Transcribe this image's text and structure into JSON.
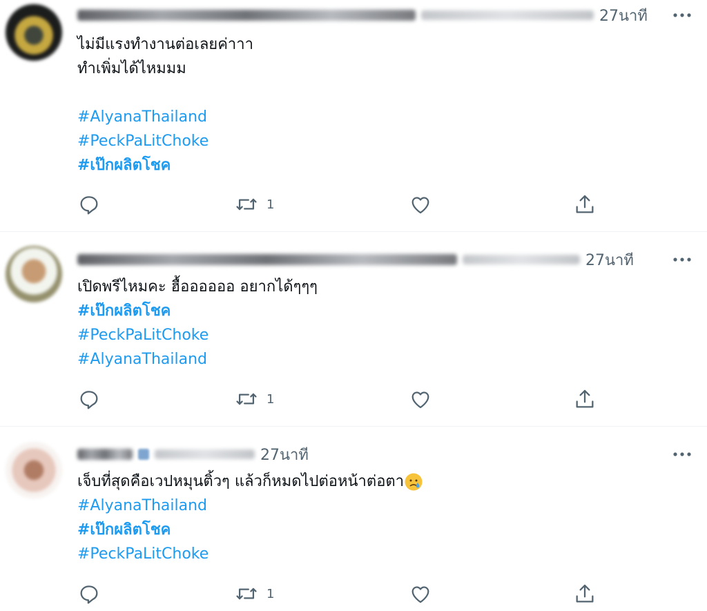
{
  "tweets": [
    {
      "time": "27นาที",
      "lines": [
        "ไม่มีแรงทำงานต่อเลยค่าาา",
        "ทำเพิ่มได้ไหมมม"
      ],
      "hashtags": [
        "#AlyanaThailand",
        "#PeckPaLitChoke",
        "#เป๊กผลิตโชค"
      ],
      "retweet_count": "1"
    },
    {
      "time": "27นาที",
      "lines": [
        "เปิดพรีไหมคะ ฮื้ออออออ อยากได้ๆๆๆ"
      ],
      "hashtags": [
        "#เป๊กผลิตโชค",
        "#PeckPaLitChoke",
        "#AlyanaThailand"
      ],
      "retweet_count": "1"
    },
    {
      "time": "27นาที",
      "lines": [
        "เจ็บที่สุดคือเวปหมุนติ้วๆ แล้วก็หมดไปต่อหน้าต่อตา"
      ],
      "hashtags": [
        "#AlyanaThailand",
        "#เป๊กผลิตโชค",
        "#PeckPaLitChoke"
      ],
      "retweet_count": "1",
      "emoji": "crying-face"
    }
  ],
  "icons": {
    "reply": "reply-icon",
    "retweet": "retweet-icon",
    "like": "like-icon",
    "share": "share-icon",
    "more": "more-icon"
  },
  "colors": {
    "hashtag": "#1d9bf0",
    "secondary_text": "#536471",
    "divider": "#eff3f4"
  }
}
